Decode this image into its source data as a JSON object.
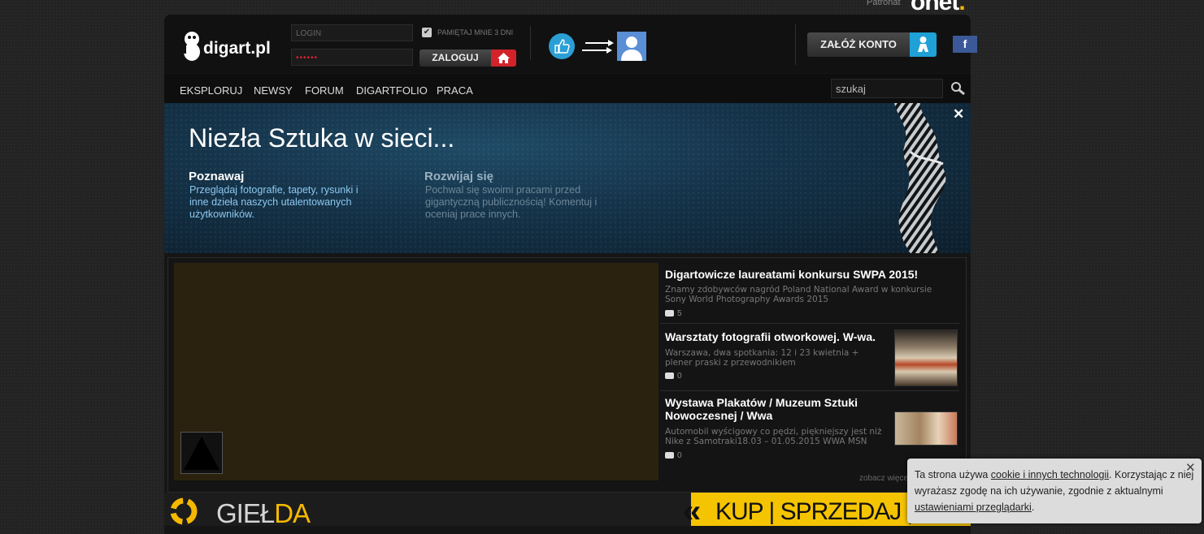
{
  "patron": {
    "label": "Patronat",
    "logo": "onet",
    "logo_dot": "."
  },
  "header": {
    "logo_text": "digart.pl",
    "login_placeholder": "LOGIN",
    "password_value": "••••••",
    "remember_label": "PAMIĘTAJ MNIE 3 DNI",
    "remember_checked": true,
    "login_button": "ZALOGUJ",
    "signup_button": "ZAŁÓŻ KONTO",
    "facebook_label": "f"
  },
  "nav": {
    "items": [
      "EKSPLORUJ",
      "NEWSY",
      "FORUM",
      "DIGARTFOLIO",
      "PRACA"
    ],
    "search_value": "szukaj"
  },
  "banner": {
    "title": "Niezła Sztuka w sieci...",
    "col1_title": "Poznawaj",
    "col1_text": "Przeglądaj fotografie, tapety, rysunki i inne dzieła naszych utalentowanych użytkowników.",
    "col2_title": "Rozwijaj się",
    "col2_text": "Pochwal się swoimi pracami przed gigantyczną publicznością! Komentuj i oceniaj prace innych.",
    "close": "✕"
  },
  "news": [
    {
      "title": "Digartowicze laureatami konkursu SWPA 2015!",
      "desc": "Znamy zdobywców nagród Poland National Award w konkursie Sony World Photography Awards 2015",
      "comments": "5"
    },
    {
      "title": "Warsztaty fotografii otworkowej. W-wa.",
      "desc": "Warszawa, dwa spotkania: 12 i 23 kwietnia + plener praski z przewodnikiem",
      "comments": "0"
    },
    {
      "title": "Wystawa Plakatów / Muzeum Sztuki Nowoczesnej / Wwa",
      "desc": "Automobil wyścigowy co pędzi, piękniejszy jest niż Nike z Samotraki18.03 – 01.05.2015 WWA MSN",
      "comments": "0"
    }
  ],
  "more_link": "zobacz więcej",
  "gielda": {
    "text": "GIEŁ",
    "text_accent": "DA",
    "slogan": "KUP | SPRZEDAJ | ZAMIEŃ"
  },
  "cookie": {
    "text_before": "Ta strona używa ",
    "link1": "cookie i innych technologii",
    "text_middle": ". Korzystając z niej wyrażasz zgodę na ich używanie, zgodnie z aktualnymi ",
    "link2": "ustawieniami przeglądarki",
    "text_after": ".",
    "close": "✕"
  },
  "colors": {
    "accent_red": "#d2232a",
    "accent_blue": "#1fa0d6",
    "facebook": "#3b5998",
    "gielda_yellow": "#f5c400"
  }
}
